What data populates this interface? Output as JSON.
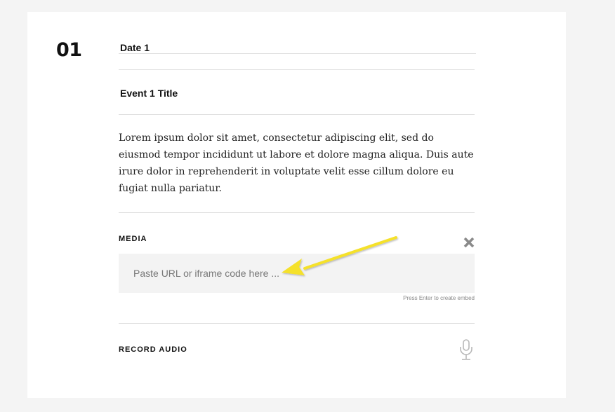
{
  "event": {
    "number": "01",
    "date": "Date 1",
    "title": "Event 1 Title",
    "description": "Lorem ipsum dolor sit amet, consectetur adipiscing elit, sed do eiusmod tempor incididunt ut labore et dolore magna aliqua. Duis aute irure dolor in reprehenderit in voluptate velit esse cillum dolore eu fugiat nulla pariatur."
  },
  "media": {
    "label": "MEDIA",
    "close_icon": "close-icon",
    "placeholder": "Paste URL or iframe code here ...",
    "value": "",
    "hint": "Press Enter to create embed"
  },
  "audio": {
    "label": "RECORD AUDIO",
    "icon": "microphone-icon"
  },
  "colors": {
    "annotation_arrow": "#f5e12a",
    "background": "#f4f4f4",
    "card": "#ffffff",
    "input_bg": "#f3f3f3"
  }
}
